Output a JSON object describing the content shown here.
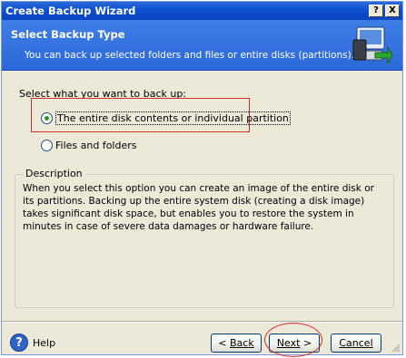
{
  "window": {
    "title": "Create Backup Wizard",
    "help_button": "?",
    "close_button": "X"
  },
  "header": {
    "title": "Select Backup Type",
    "subtitle": "You can back up selected folders and files or entire disks (partitions).",
    "icon": "backup-wizard-icon"
  },
  "main": {
    "prompt": "Select what you want to back up:",
    "options": [
      {
        "label": "The entire disk contents or individual partition",
        "selected": true
      },
      {
        "label": "Files and folders",
        "selected": false
      }
    ]
  },
  "description": {
    "label": "Description",
    "text": "When you select this option you can create an image of the entire disk or its partitions. Backing up the entire system disk (creating a disk image) takes significant disk space, but enables you to restore the system in minutes in case of severe data damages or hardware failure."
  },
  "footer": {
    "help_label": "Help",
    "back_prefix": "< ",
    "back_label": "Back",
    "next_label": "Next",
    "next_suffix": " >",
    "cancel_label": "Cancel"
  },
  "colors": {
    "titlebar": "#0a44c2",
    "header": "#2c69d9",
    "dialog_bg": "#ece9d8",
    "highlight_annotation": "#d62a2a"
  }
}
